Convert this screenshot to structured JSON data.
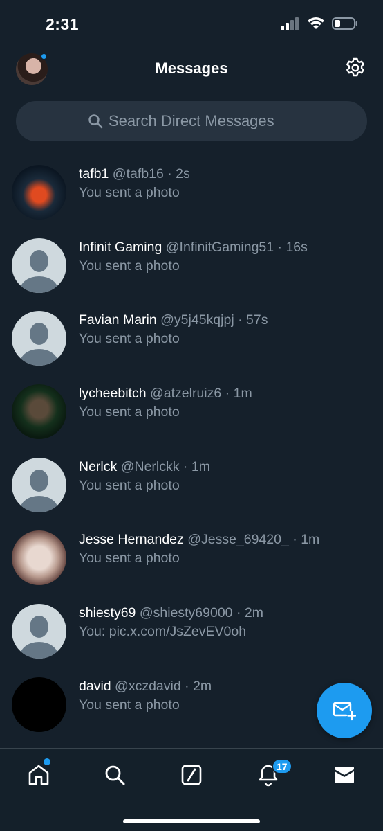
{
  "status_bar": {
    "time": "2:31"
  },
  "header": {
    "title": "Messages"
  },
  "search": {
    "placeholder": "Search Direct Messages"
  },
  "conversations": [
    {
      "name": "tafb1",
      "handle": "@tafb16",
      "time": "2s",
      "preview": "You sent a photo"
    },
    {
      "name": "Infinit Gaming",
      "handle": "@InfinitGaming51",
      "time": "16s",
      "preview": "You sent a photo"
    },
    {
      "name": "Favian Marin",
      "handle": "@y5j45kqjpj",
      "time": "57s",
      "preview": "You sent a photo"
    },
    {
      "name": "lycheebitch",
      "handle": "@atzelruiz6",
      "time": "1m",
      "preview": "You sent a photo"
    },
    {
      "name": "Nerlck",
      "handle": "@Nerlckk",
      "time": "1m",
      "preview": "You sent a photo"
    },
    {
      "name": "Jesse Hernandez",
      "handle": "@Jesse_69420_",
      "time": "1m",
      "preview": "You sent a photo"
    },
    {
      "name": "shiesty69",
      "handle": "@shiesty69000",
      "time": "2m",
      "preview": "You:  pic.x.com/JsZevEV0oh"
    },
    {
      "name": "david",
      "handle": "@xczdavid",
      "time": "2m",
      "preview": "You sent a photo"
    }
  ],
  "tabbar": {
    "notifications_badge": "17"
  },
  "icons": {
    "settings": "gear-icon",
    "search": "search-icon",
    "compose": "new-message-icon",
    "home": "home-icon",
    "explore": "search-icon",
    "grok": "slash-box-icon",
    "notifications": "bell-icon",
    "messages": "envelope-icon"
  },
  "colors": {
    "background": "#15202b",
    "accent": "#1d9bf0",
    "secondary_text": "#8b98a5",
    "search_bg": "#273340"
  }
}
